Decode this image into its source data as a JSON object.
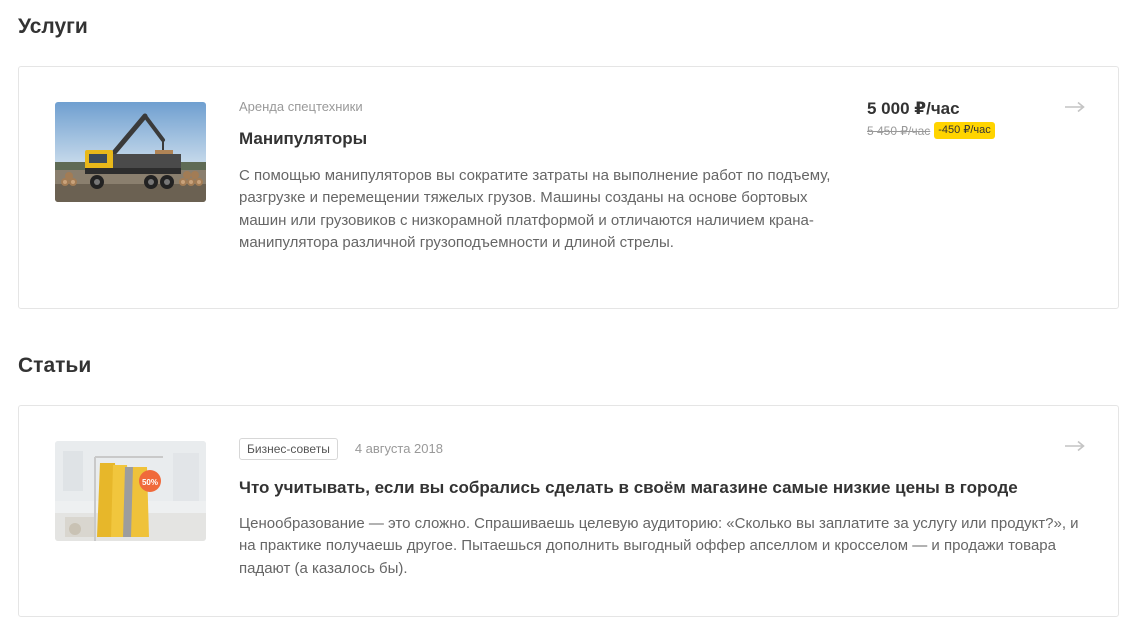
{
  "services_section": {
    "title": "Услуги",
    "card": {
      "category": "Аренда спецтехники",
      "name": "Манипуляторы",
      "description": "С помощью манипуляторов вы сократите затраты на выполнение работ по подъему, разгрузке и перемещении тяжелых грузов. Машины созданы на основе бортовых машин или грузовиков с низкорамной платформой и отличаются наличием крана-манипулятора различной грузоподъемности и длиной стрелы.",
      "price": "5 000 ₽/час",
      "old_price": "5 450 ₽/час",
      "discount": "-450 ₽/час",
      "image_icon": "manipulator-truck-photo",
      "arrow_icon": "arrow-right-icon"
    }
  },
  "articles_section": {
    "title": "Статьи",
    "card": {
      "tag": "Бизнес-советы",
      "date": "4 августа 2018",
      "title": "Что учитывать, если вы собрались сделать в своём магазине самые низкие цены в городе",
      "description": "Ценообразование — это сложно. Спрашиваешь целевую аудиторию: «Сколько вы заплатите за услугу или продукт?», и на практике получаешь другое. Пытаешься дополнить выгодный оффер апселлом и кросселом — и продажи товара падают (а казалось бы).",
      "image_icon": "clothing-rack-sale-photo",
      "image_badge": "50%",
      "arrow_icon": "arrow-right-icon"
    }
  },
  "colors": {
    "accent_yellow": "#ffd400",
    "text_main": "#333333",
    "text_muted": "#999999",
    "border": "#e5e5e5"
  }
}
